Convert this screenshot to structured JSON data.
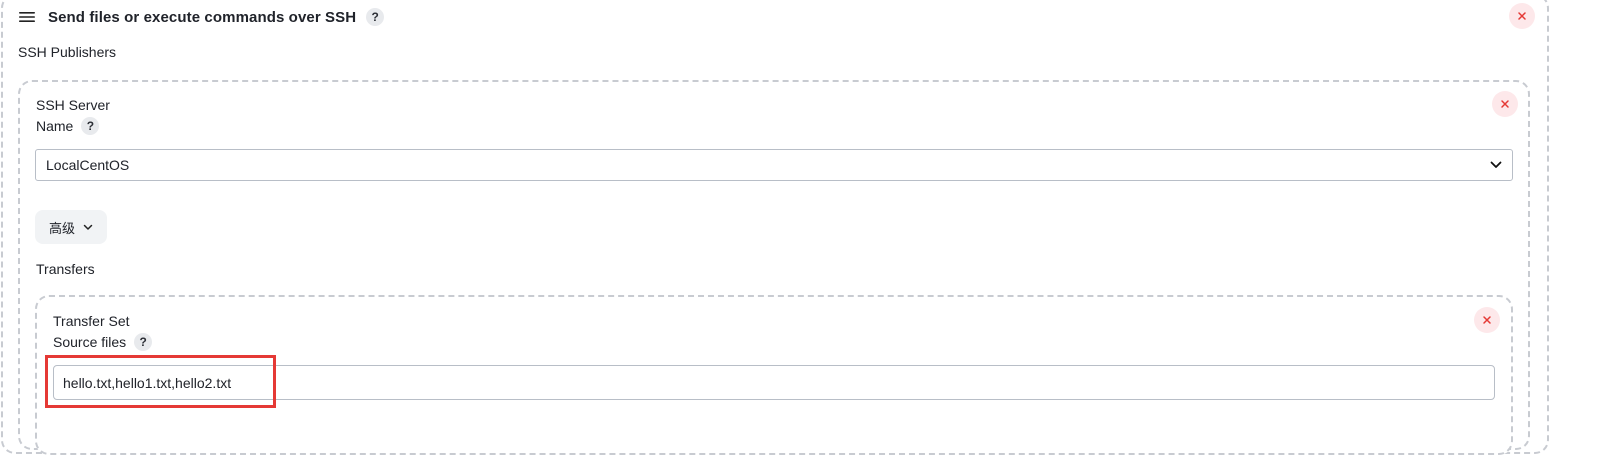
{
  "section": {
    "title": "Send files or execute commands over SSH",
    "help": "?",
    "publishers_label": "SSH Publishers"
  },
  "server": {
    "label": "SSH Server",
    "name_label": "Name",
    "help": "?",
    "selected_name": "LocalCentOS",
    "advanced_label": "高级"
  },
  "transfers": {
    "label": "Transfers",
    "set_label": "Transfer Set",
    "source_files_label": "Source files",
    "help": "?",
    "source_files_value": "hello.txt,hello1.txt,hello2.txt"
  },
  "icons": {
    "menu": "hamburger-icon",
    "help": "question-icon",
    "close": "close-icon",
    "dropdown": "chevron-down-icon"
  },
  "colors": {
    "close_background": "#fde8ea",
    "close_icon": "#e53935",
    "highlight": "#e53935",
    "dashed_border": "#c8cbd1"
  }
}
